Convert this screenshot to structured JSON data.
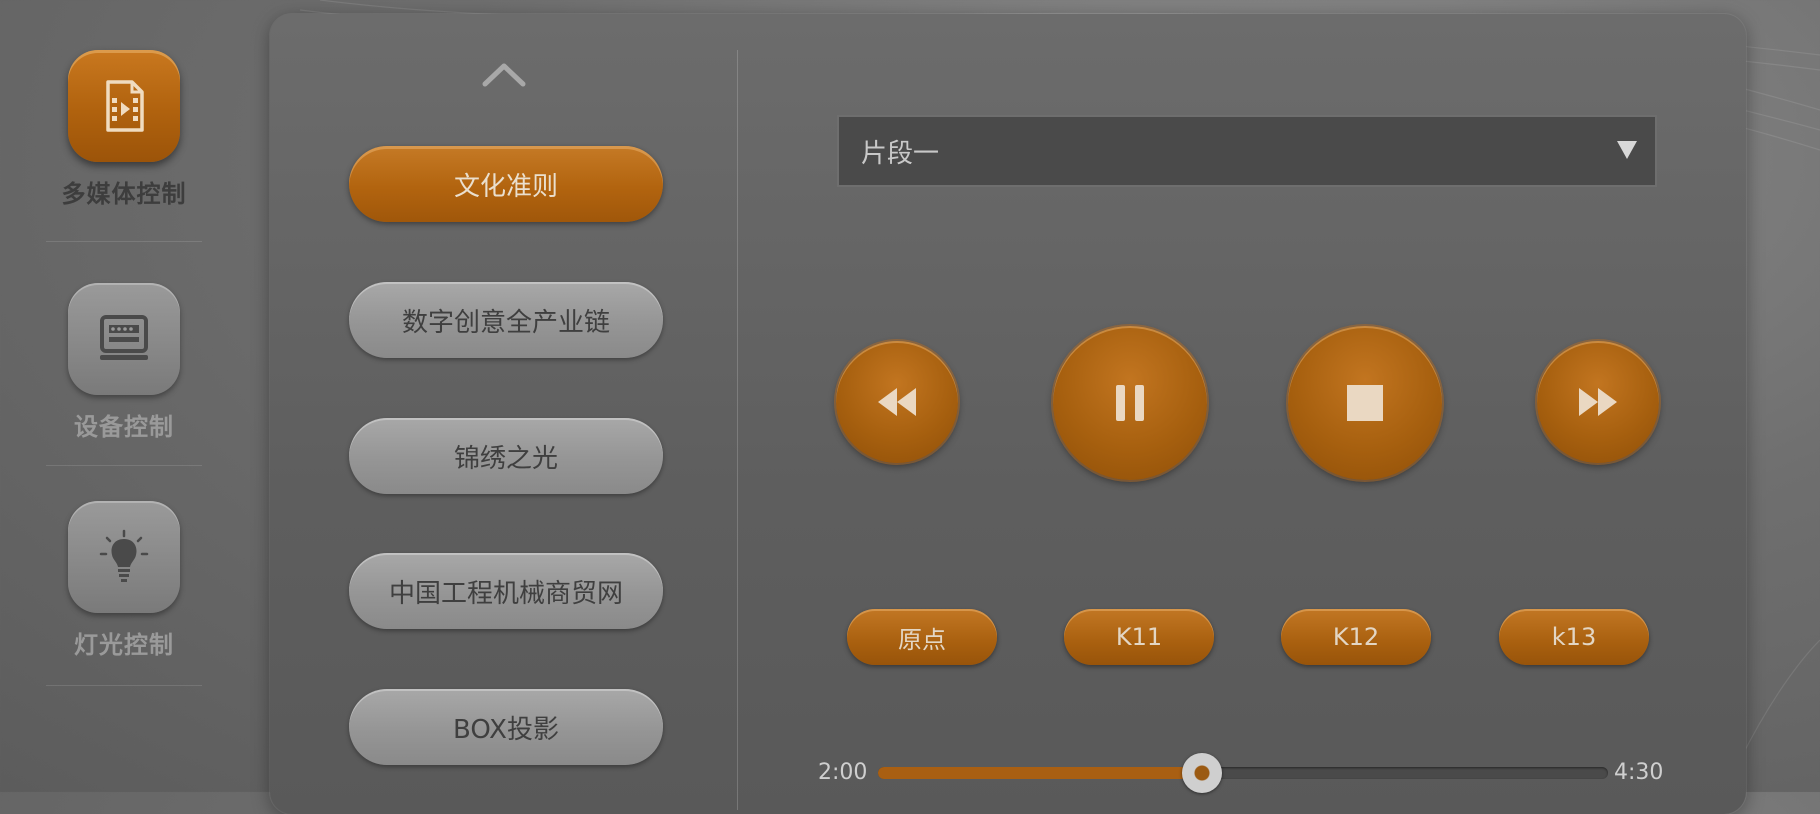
{
  "nav": {
    "items": [
      {
        "label": "多媒体控制",
        "icon": "video-file-icon",
        "active": true
      },
      {
        "label": "设备控制",
        "icon": "monitor-icon",
        "active": false
      },
      {
        "label": "灯光控制",
        "icon": "lightbulb-icon",
        "active": false
      }
    ]
  },
  "content_list": {
    "items": [
      {
        "label": "文化准则",
        "active": true
      },
      {
        "label": "数字创意全产业链",
        "active": false
      },
      {
        "label": "锦绣之光",
        "active": false
      },
      {
        "label": "中国工程机械商贸网",
        "active": false
      },
      {
        "label": "BOX投影",
        "active": false
      }
    ]
  },
  "segment": {
    "selected": "片段一"
  },
  "transport": {
    "rewind": "rewind-icon",
    "pause": "pause-icon",
    "stop": "stop-icon",
    "fast_forward": "fast-forward-icon"
  },
  "presets": [
    {
      "label": "原点"
    },
    {
      "label": "K11"
    },
    {
      "label": "K12"
    },
    {
      "label": "k13"
    }
  ],
  "progress": {
    "current": "2:00",
    "total": "4:30",
    "fraction": 0.4444
  },
  "colors": {
    "accent": "#b0620e",
    "background": "#6f6f6f",
    "panel": "#5e5e5e"
  }
}
